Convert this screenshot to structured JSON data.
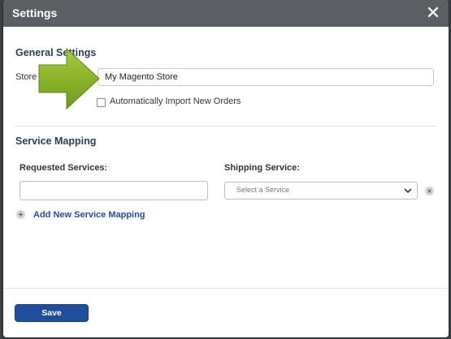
{
  "dialog": {
    "title": "Settings",
    "close_glyph": "✕"
  },
  "general": {
    "heading": "General Settings",
    "store_label": "Store",
    "store_value": "My Magento Store",
    "auto_import_label": "Automatically Import New Orders",
    "auto_import_checked": false
  },
  "mapping": {
    "heading": "Service Mapping",
    "requested_label": "Requested Services:",
    "shipping_label": "Shipping Service:",
    "requested_value": "",
    "shipping_placeholder": "Select a Service",
    "add_link": "Add New Service Mapping"
  },
  "footer": {
    "save_label": "Save"
  },
  "annotation": {
    "arrow_color": "#8dbb2a"
  },
  "colors": {
    "header_bg": "#5b5e62",
    "primary": "#1f4e9c",
    "link": "#1f4e9c"
  }
}
